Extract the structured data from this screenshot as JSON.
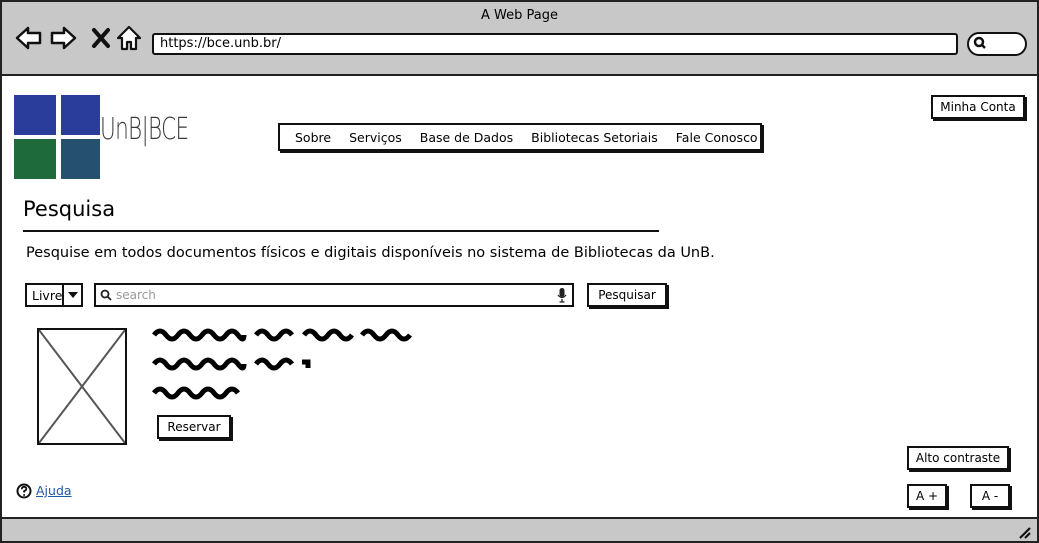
{
  "window": {
    "title": "A Web Page"
  },
  "browser": {
    "url": "https://bce.unb.br/",
    "icons": [
      "back-arrow-icon",
      "forward-arrow-icon",
      "close-x-icon",
      "home-icon",
      "search-icon"
    ]
  },
  "header": {
    "logo_text": "UnB|BCE",
    "account_button": "Minha Conta",
    "menu": [
      "Sobre",
      "Serviços",
      "Base de Dados",
      "Bibliotecas Setoriais",
      "Fale Conosco"
    ]
  },
  "main": {
    "title": "Pesquisa",
    "description": "Pesquise em todos documentos físicos e digitais disponíveis no sistema de Bibliotecas da UnB.",
    "search": {
      "mode": "Livre",
      "placeholder": "search",
      "button": "Pesquisar"
    },
    "result": {
      "reserve_button": "Reservar"
    }
  },
  "accessibility": {
    "contrast_button": "Alto contraste",
    "increase_font": "A +",
    "decrease_font": "A -"
  },
  "footer": {
    "help_link": "Ajuda"
  },
  "colors": {
    "chrome": "#c8c8c8",
    "logo_blue": "#2a3d9a",
    "logo_green": "#1f6a3a",
    "link": "#2255aa"
  }
}
